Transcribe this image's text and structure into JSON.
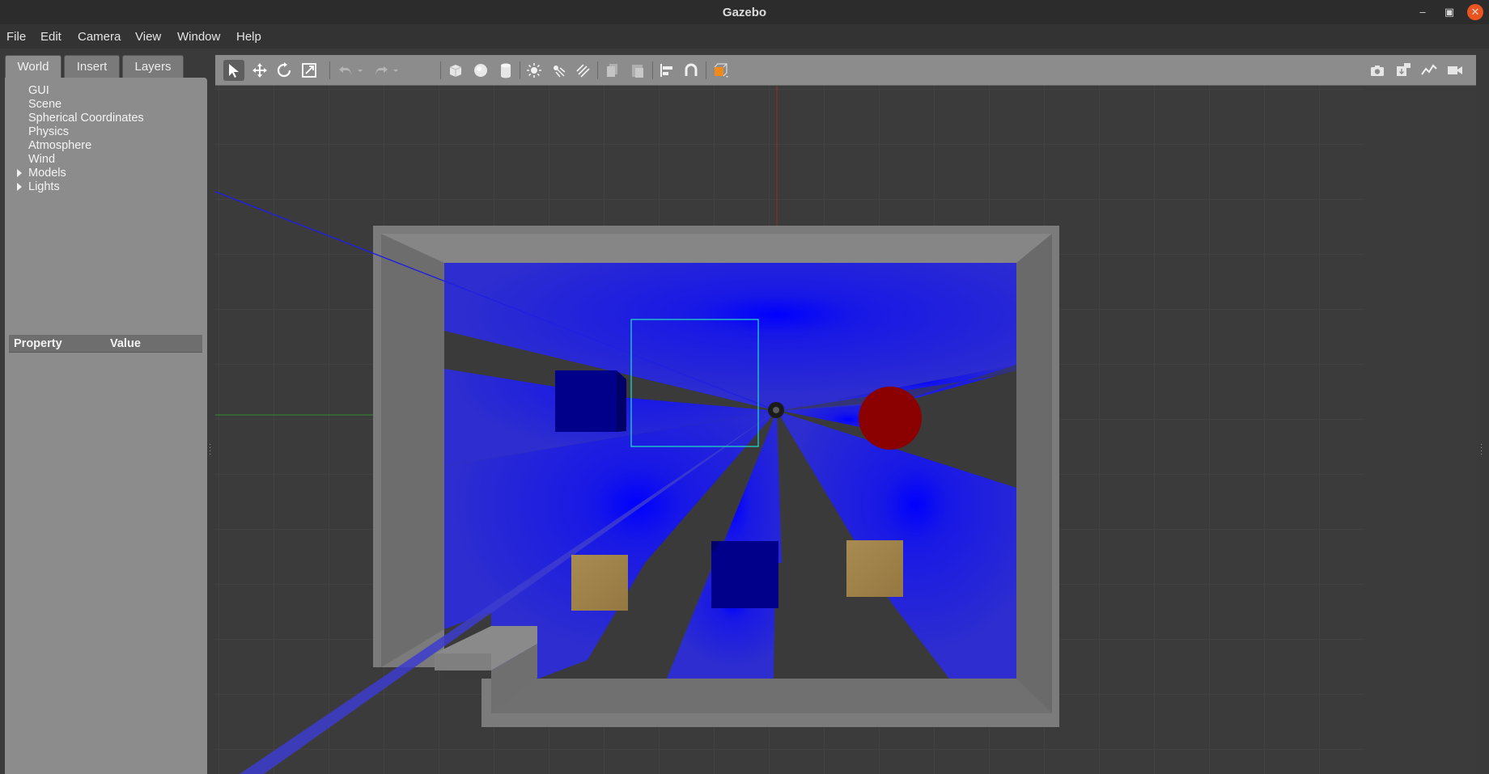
{
  "window": {
    "title": "Gazebo"
  },
  "menu": [
    "File",
    "Edit",
    "Camera",
    "View",
    "Window",
    "Help"
  ],
  "tabs": {
    "world": "World",
    "insert": "Insert",
    "layers": "Layers"
  },
  "tree": {
    "items": [
      {
        "label": "GUI",
        "expandable": false
      },
      {
        "label": "Scene",
        "expandable": false
      },
      {
        "label": "Spherical Coordinates",
        "expandable": false
      },
      {
        "label": "Physics",
        "expandable": false
      },
      {
        "label": "Atmosphere",
        "expandable": false
      },
      {
        "label": "Wind",
        "expandable": false
      },
      {
        "label": "Models",
        "expandable": true
      },
      {
        "label": "Lights",
        "expandable": true
      }
    ]
  },
  "properties": {
    "col_property": "Property",
    "col_value": "Value"
  },
  "toolbar": {
    "tools": [
      "select-arrow-icon",
      "translate-icon",
      "rotate-icon",
      "scale-icon",
      "undo-icon",
      "redo-icon",
      "box-icon",
      "sphere-icon",
      "cylinder-icon",
      "point-light-icon",
      "spot-light-icon",
      "directional-light-icon",
      "copy-icon",
      "paste-icon",
      "align-icon",
      "snap-magnet-icon",
      "view-angle-icon"
    ],
    "right_tools": [
      "screenshot-icon",
      "log-icon",
      "plot-icon",
      "record-video-icon"
    ]
  },
  "colors": {
    "accent_close": "#e95420",
    "laser_blue": "#2323d8",
    "obstacle_blue": "#00008b",
    "ball_red": "#8b0000",
    "box_brown": "#a08248",
    "wall_gray": "#7a7a7a",
    "selection_cyan": "#22d3c5"
  }
}
